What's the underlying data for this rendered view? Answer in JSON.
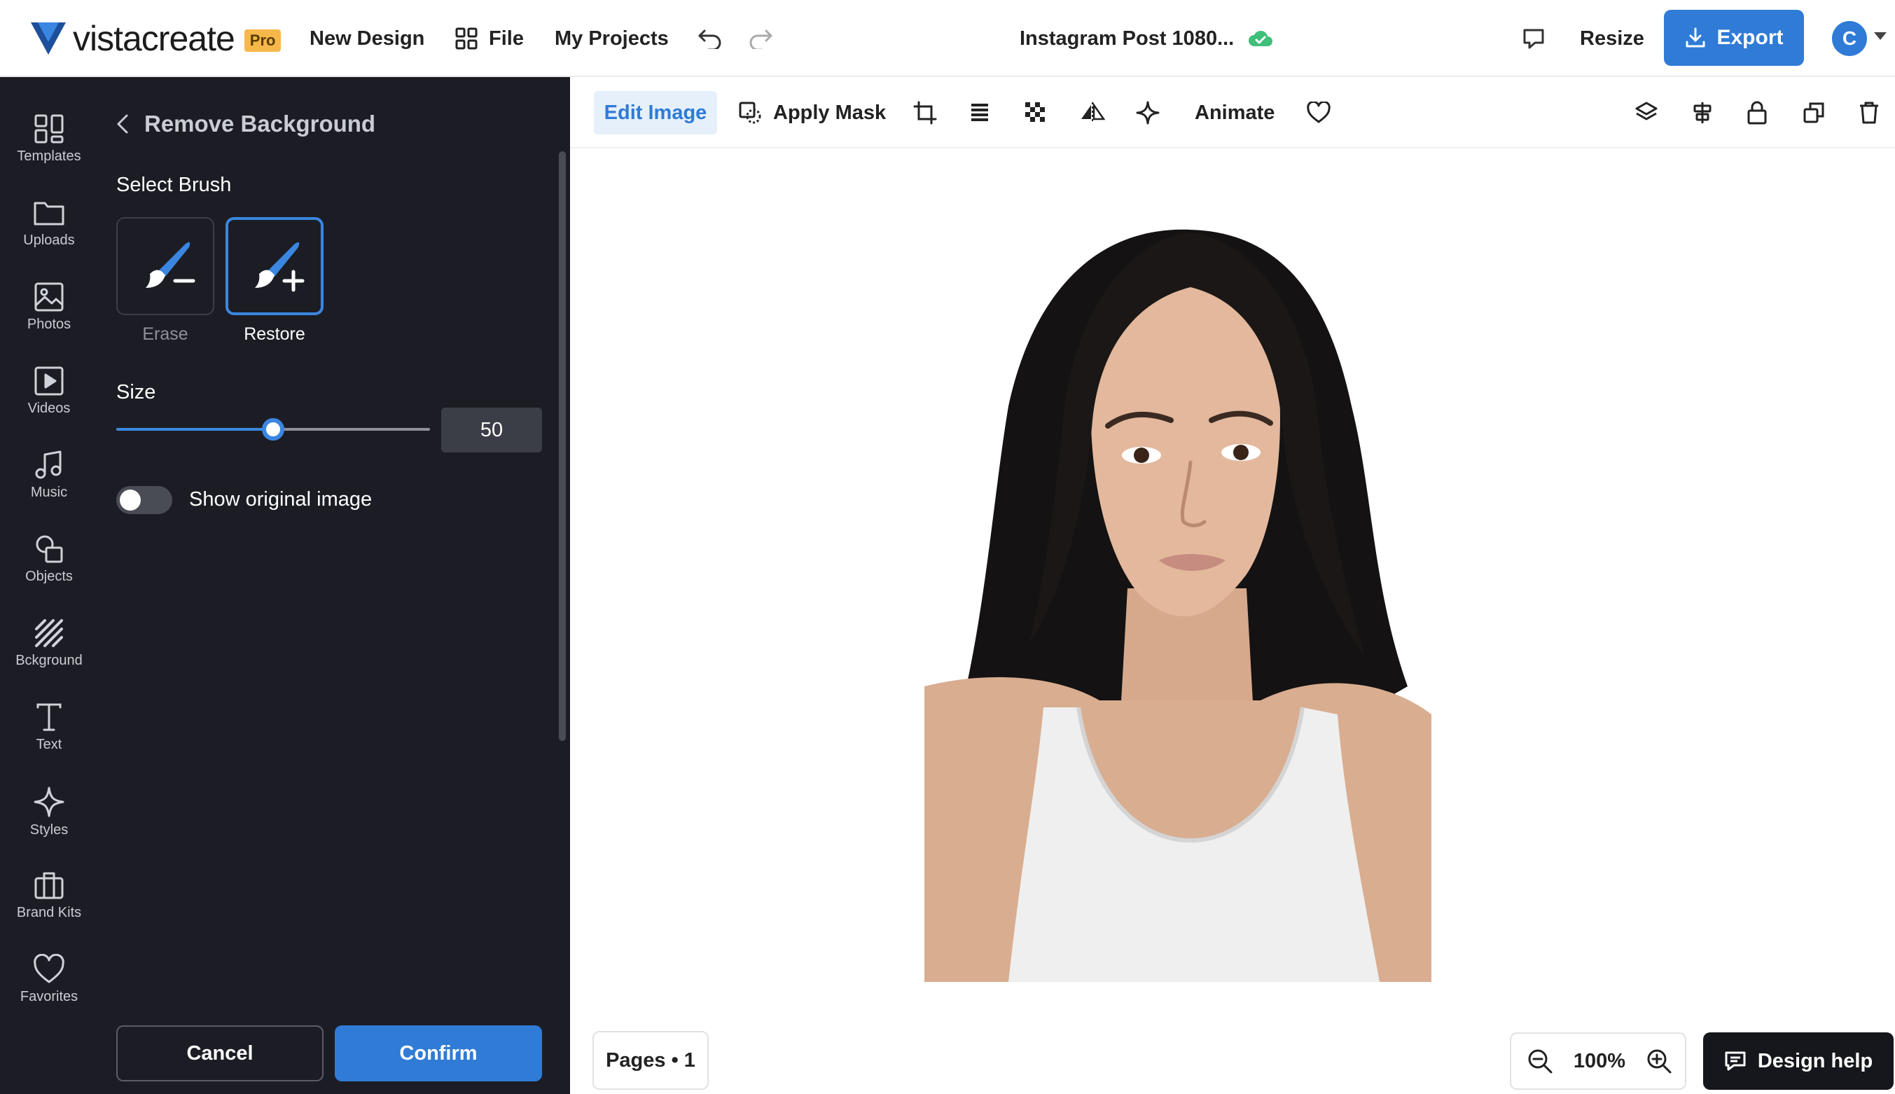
{
  "topbar": {
    "brand": "vistacreate",
    "pro_badge": "Pro",
    "new_design": "New Design",
    "file": "File",
    "my_projects": "My Projects",
    "doc_title": "Instagram Post 1080...",
    "resize": "Resize",
    "export": "Export",
    "avatar_initial": "C"
  },
  "nav": {
    "items": [
      {
        "label": "Templates",
        "icon": "templates-icon"
      },
      {
        "label": "Uploads",
        "icon": "folder-icon"
      },
      {
        "label": "Photos",
        "icon": "image-icon"
      },
      {
        "label": "Videos",
        "icon": "video-icon"
      },
      {
        "label": "Music",
        "icon": "music-note-icon"
      },
      {
        "label": "Objects",
        "icon": "shapes-icon"
      },
      {
        "label": "Bckground",
        "icon": "stripes-icon"
      },
      {
        "label": "Text",
        "icon": "text-t-icon"
      },
      {
        "label": "Styles",
        "icon": "sparkle-icon"
      },
      {
        "label": "Brand Kits",
        "icon": "briefcase-icon"
      },
      {
        "label": "Favorites",
        "icon": "heart-icon"
      }
    ]
  },
  "panel": {
    "title": "Remove Background",
    "select_brush": "Select Brush",
    "brushes": [
      {
        "label": "Erase",
        "active": false
      },
      {
        "label": "Restore",
        "active": true
      }
    ],
    "size_label": "Size",
    "size_value": "50",
    "size_min": 0,
    "size_max": 100,
    "show_original_label": "Show original image",
    "show_original_on": false,
    "cancel": "Cancel",
    "confirm": "Confirm"
  },
  "toolbar": {
    "edit_image": "Edit Image",
    "apply_mask": "Apply Mask",
    "animate": "Animate"
  },
  "bottom": {
    "pages": "Pages • 1",
    "zoom": "100%",
    "design_help": "Design help"
  },
  "colors": {
    "accent": "#2f7bd6",
    "panel_bg": "#1c1d24",
    "saved_ok": "#3fbf7a"
  }
}
